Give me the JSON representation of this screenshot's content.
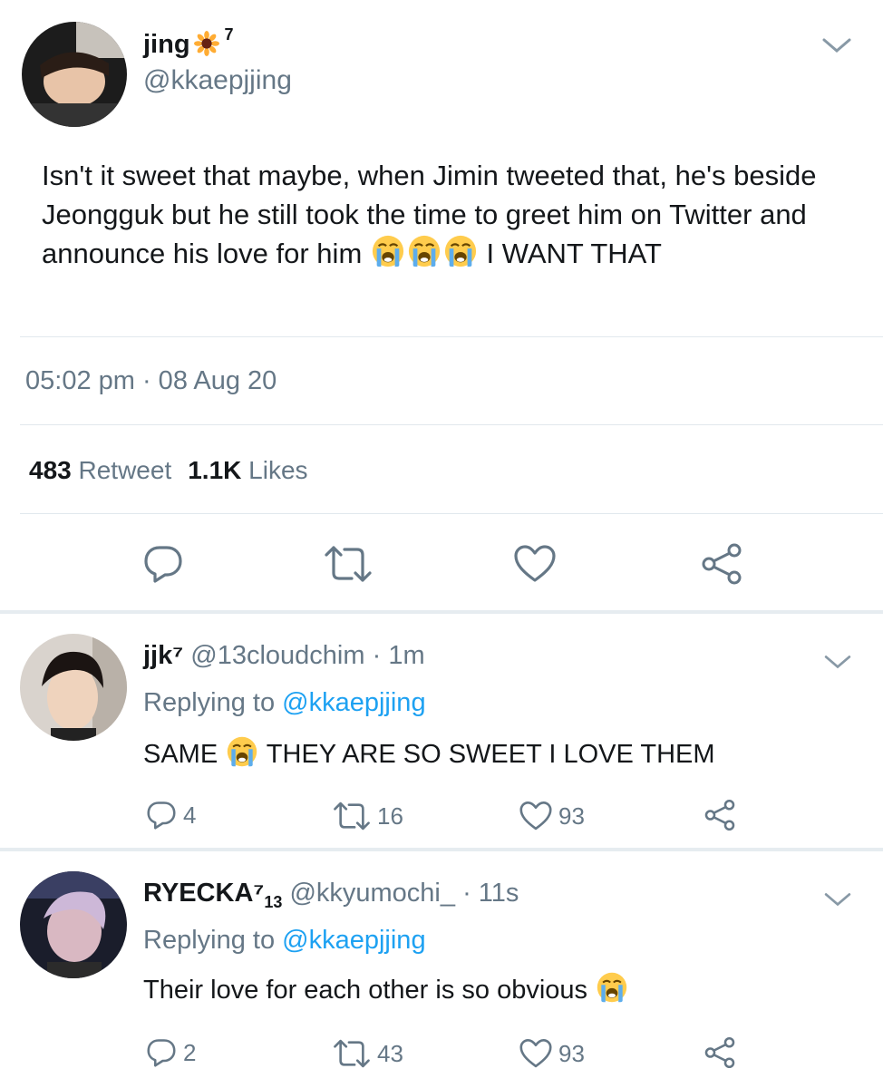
{
  "main_tweet": {
    "display_name": "jing",
    "name_superscript": "7",
    "handle": "@kkaepjjing",
    "text_part1": "Isn't it sweet that maybe, when Jimin tweeted that, he's beside Jeongguk but he still took the time to greet him on Twitter and announce his love for him",
    "text_part2": "I WANT THAT",
    "timestamp": "05:02 pm · 08 Aug 20",
    "retweets_count": "483",
    "retweets_label": "Retweet",
    "likes_count": "1.1K",
    "likes_label": "Likes"
  },
  "replies": [
    {
      "display_name": "jjk⁷",
      "handle": "@13cloudchim",
      "time": "· 1m",
      "replying_prefix": "Replying to",
      "replying_mention": "@kkaepjjing",
      "text_before_emoji": "SAME",
      "text_after_emoji": "THEY ARE SO SWEET I LOVE THEM",
      "reply_count": "4",
      "retweet_count": "16",
      "like_count": "93"
    },
    {
      "display_name": "RYECKA⁷",
      "name_subscript": "13",
      "handle": "@kkyumochi_",
      "time": "· 11s",
      "replying_prefix": "Replying to",
      "replying_mention": "@kkaepjjing",
      "text_before_emoji": "Their love for each other is so obvious",
      "reply_count": "2",
      "retweet_count": "43",
      "like_count": "93"
    }
  ],
  "colors": {
    "text_primary": "#14171a",
    "text_secondary": "#657786",
    "link": "#1da1f2",
    "divider": "#e1e8ed"
  },
  "icons": {
    "reply": "reply-icon",
    "retweet": "retweet-icon",
    "like": "heart-icon",
    "share": "share-icon",
    "more": "chevron-down-icon",
    "emoji": "loudly-crying-face-emoji",
    "name_emoji": "sunflower-emoji"
  }
}
